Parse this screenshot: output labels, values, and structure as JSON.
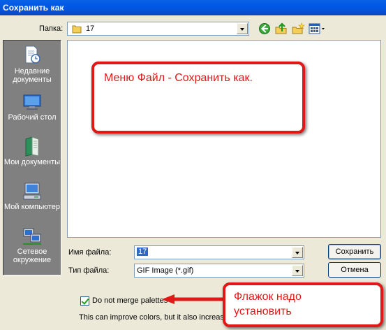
{
  "window": {
    "title": "Сохранить как"
  },
  "folder": {
    "label": "Папка:",
    "value": "17"
  },
  "places": [
    {
      "label": "Недавние документы",
      "icon": "recent-documents-icon"
    },
    {
      "label": "Рабочий стол",
      "icon": "desktop-icon"
    },
    {
      "label": "Мои документы",
      "icon": "my-documents-icon"
    },
    {
      "label": "Мой компьютер",
      "icon": "my-computer-icon"
    },
    {
      "label": "Сетевое окружение",
      "icon": "network-icon"
    }
  ],
  "filename": {
    "label": "Имя файла:",
    "value": "17"
  },
  "filetype": {
    "label": "Тип файла:",
    "value": "GIF Image (*.gif)"
  },
  "buttons": {
    "save": "Сохранить",
    "cancel": "Отмена"
  },
  "options": {
    "merge_checkbox_label": "Do not merge palettes",
    "merge_checked": true,
    "hint": "This can improve colors, but it also increases"
  },
  "annotations": {
    "top_callout": "Меню Файл - Сохранить как.",
    "bottom_callout_line1": "Флажок надо",
    "bottom_callout_line2": "установить",
    "color": "#e01818"
  },
  "colors": {
    "titlebar": "#0058e6",
    "dialog": "#ece9d8",
    "places_bar": "#808080"
  }
}
